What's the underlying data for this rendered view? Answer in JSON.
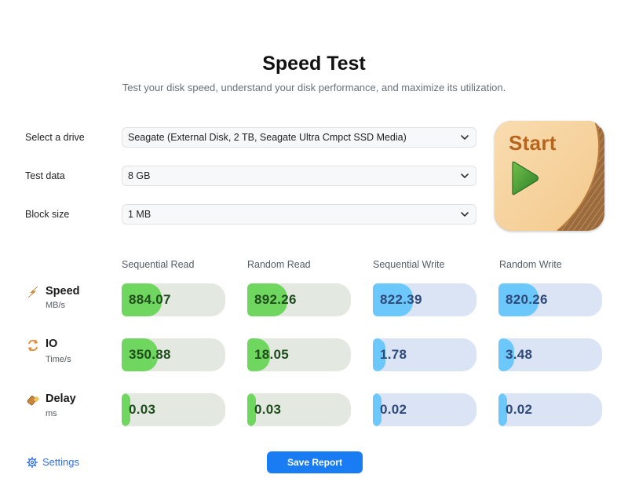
{
  "header": {
    "title": "Speed Test",
    "subtitle": "Test your disk speed, understand your disk performance, and maximize its utilization."
  },
  "form": {
    "drive_label": "Select a drive",
    "drive_value": "Seagate (External Disk, 2 TB, Seagate Ultra Cmpct SSD Media)",
    "testdata_label": "Test data",
    "testdata_value": "8 GB",
    "blocksize_label": "Block size",
    "blocksize_value": "1 MB"
  },
  "start_button": {
    "label": "Start",
    "icon": "play-icon"
  },
  "columns": [
    "Sequential Read",
    "Random Read",
    "Sequential Write",
    "Random Write"
  ],
  "metrics": [
    {
      "name": "Speed",
      "unit": "MB/s",
      "icon": "lightning-icon",
      "values": [
        "884.07",
        "892.26",
        "822.39",
        "820.26"
      ],
      "fill": [
        0.39,
        0.39,
        0.39,
        0.39
      ]
    },
    {
      "name": "IO",
      "unit": "Time/s",
      "icon": "refresh-arrows-icon",
      "values": [
        "350.88",
        "18.05",
        "1.78",
        "3.48"
      ],
      "fill": [
        0.35,
        0.22,
        0.12,
        0.15
      ]
    },
    {
      "name": "Delay",
      "unit": "ms",
      "icon": "eraser-icon",
      "values": [
        "0.03",
        "0.03",
        "0.02",
        "0.02"
      ],
      "fill": [
        0.08,
        0.08,
        0.08,
        0.08
      ]
    }
  ],
  "footer": {
    "settings_label": "Settings",
    "settings_icon": "gear-icon",
    "save_label": "Save Report"
  },
  "colors": {
    "read_fill": "#6fd65f",
    "read_track": "#e3e9e0",
    "write_fill": "#6cc8fb",
    "write_track": "#dae4f5",
    "accent": "#1a7cf3",
    "start_text": "#b5651d"
  }
}
